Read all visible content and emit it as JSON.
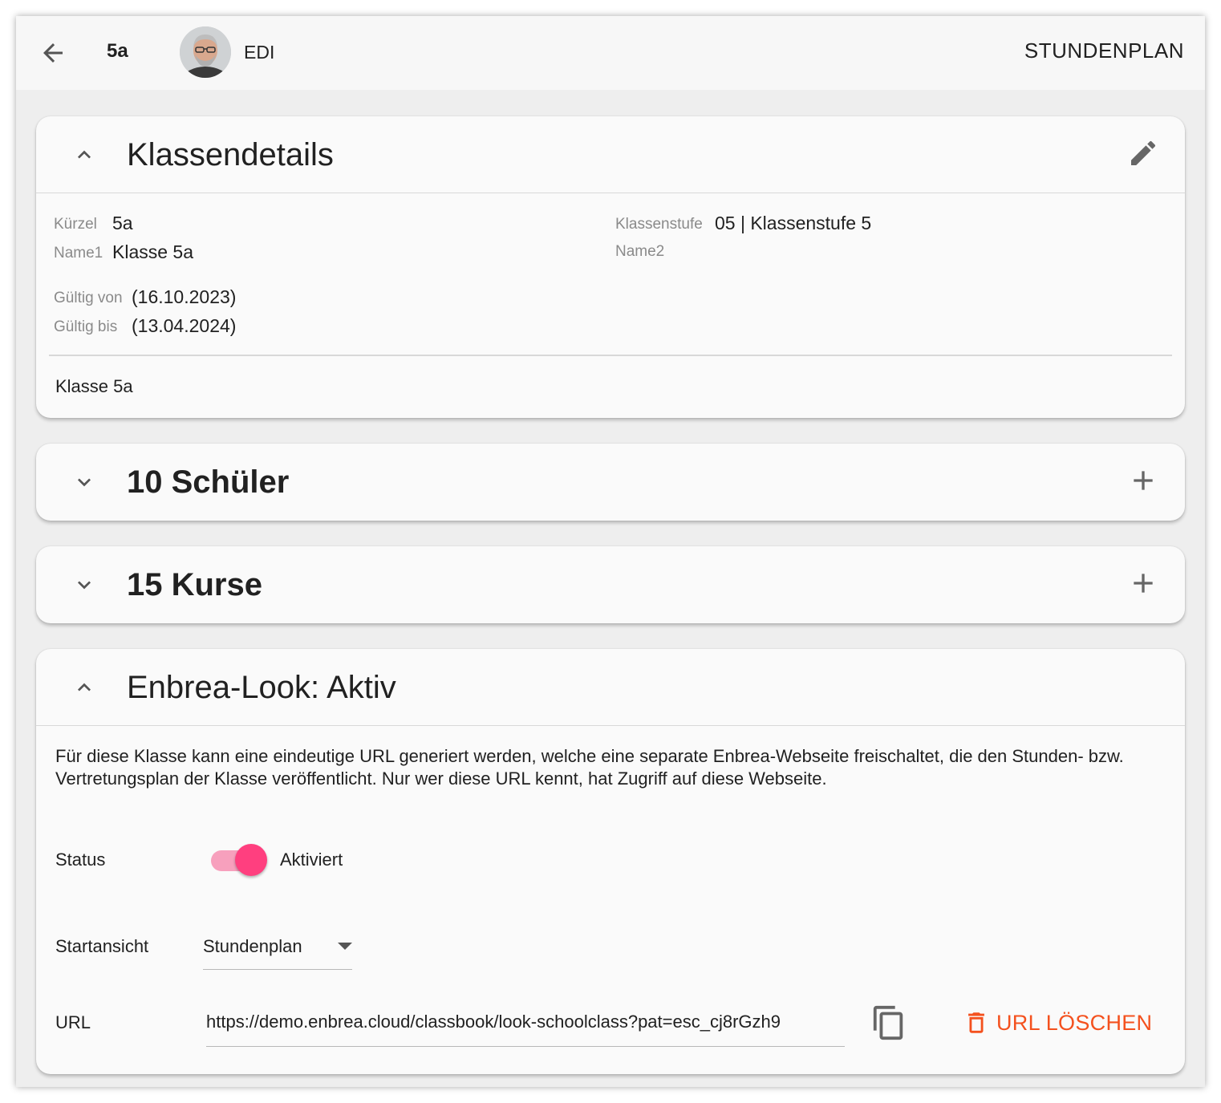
{
  "appbar": {
    "class_short": "5a",
    "user_name": "EDI",
    "action_label": "STUNDENPLAN"
  },
  "klassendetails": {
    "title": "Klassendetails",
    "kuerzel_label": "Kürzel",
    "kuerzel_value": "5a",
    "name1_label": "Name1",
    "name1_value": "Klasse 5a",
    "klassenstufe_label": "Klassenstufe",
    "klassenstufe_value": "05 | Klassenstufe 5",
    "name2_label": "Name2",
    "name2_value": "",
    "gueltig_von_label": "Gültig von",
    "gueltig_von_value": "(16.10.2023)",
    "gueltig_bis_label": "Gültig bis",
    "gueltig_bis_value": "(13.04.2024)",
    "description": "Klasse 5a"
  },
  "schueler": {
    "title": "10 Schüler"
  },
  "kurse": {
    "title": "15 Kurse"
  },
  "look": {
    "title": "Enbrea-Look: Aktiv",
    "description": "Für diese Klasse kann eine eindeutige URL generiert werden, welche eine separate Enbrea-Webseite freischaltet, die den Stunden- bzw. Vertretungsplan der Klasse veröffentlicht. Nur wer diese URL kennt, hat Zugriff auf diese Webseite.",
    "status_label": "Status",
    "status_value": "Aktiviert",
    "startansicht_label": "Startansicht",
    "startansicht_value": "Stundenplan",
    "url_label": "URL",
    "url_value": "https://demo.enbrea.cloud/classbook/look-schoolclass?pat=esc_cj8rGzh9",
    "delete_label": "URL LÖSCHEN"
  },
  "colors": {
    "accent_pink": "#ff3f7f",
    "delete_orange": "#f4511e",
    "background": "#eeeeee",
    "card": "#fafafa"
  },
  "icons": {
    "back": "arrow-left-icon",
    "collapse": "chevron-up-icon",
    "expand": "chevron-down-icon",
    "edit": "pencil-icon",
    "add": "plus-icon",
    "copy": "copy-icon",
    "delete": "trash-icon"
  }
}
